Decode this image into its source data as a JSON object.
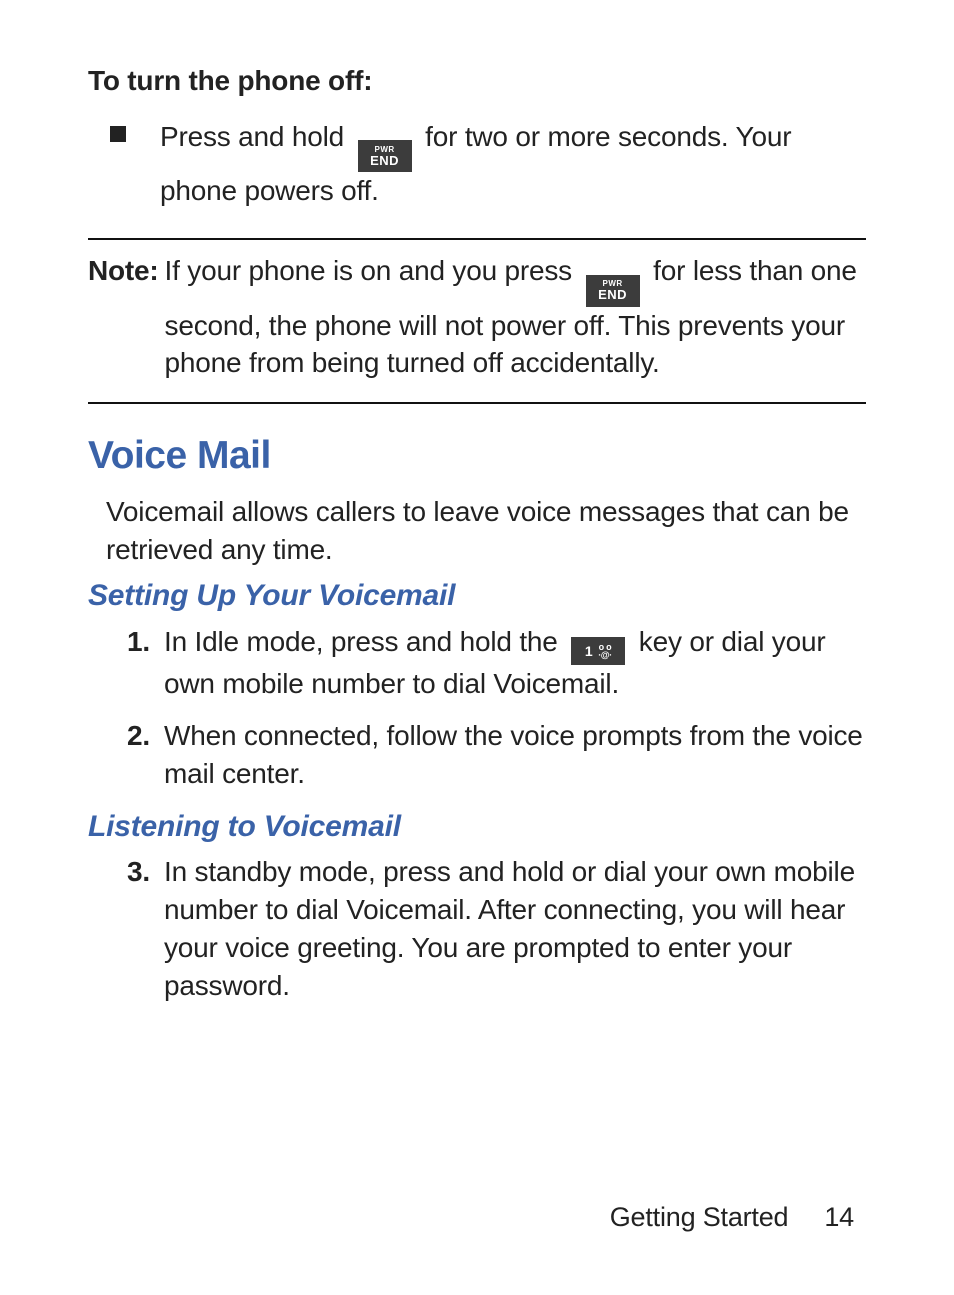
{
  "turn_off": {
    "heading": "To turn the phone off:",
    "bullet_before": "Press and hold ",
    "bullet_after": " for two or more seconds. Your phone powers off."
  },
  "pwr_key": {
    "line1": "PWR",
    "line2": "END"
  },
  "note": {
    "label": "Note:",
    "before": "If your phone is on and you press ",
    "after": " for less than one second, the phone will not power off. This prevents your phone from being turned off accidentally."
  },
  "voicemail": {
    "heading": "Voice Mail",
    "intro": "Voicemail allows callers to leave voice messages that can be retrieved any time.",
    "setup_heading": "Setting Up Your Voicemail",
    "step1_before": "In Idle mode, press and hold the ",
    "step1_after": " key or dial your own mobile number to dial Voicemail.",
    "step2": "When connected, follow the voice prompts from the voice mail center.",
    "listen_heading": "Listening to Voicemail",
    "step3": "In standby mode, press and hold or dial your own mobile number to dial Voicemail. After connecting, you will hear your voice greeting. You are prompted to enter your password."
  },
  "nums": {
    "n1": "1.",
    "n2": "2.",
    "n3": "3."
  },
  "one_key": {
    "digit": "1",
    "vm_top": "o o",
    "vm_bot": "∙@∙"
  },
  "footer": {
    "section": "Getting Started",
    "page": "14"
  }
}
